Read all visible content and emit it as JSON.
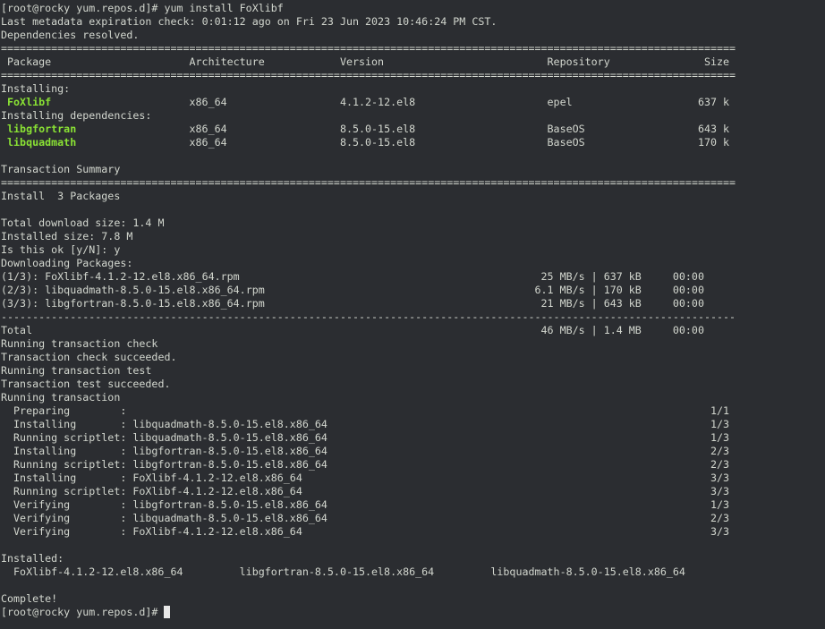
{
  "theme": {
    "background": "#2b2d31",
    "text": "#d3d7cf",
    "package_highlight": "#8ae234"
  },
  "terminal": {
    "prompt": "[root@rocky yum.repos.d]# ",
    "command": "yum install FoXlibf",
    "metadata_line": "Last metadata expiration check: 0:01:12 ago on Fri 23 Jun 2023 10:46:24 PM CST.",
    "deps_resolved": "Dependencies resolved.",
    "separator_char": "=",
    "dash_char": "-",
    "table": {
      "headers": {
        "package": "Package",
        "arch": "Architecture",
        "version": "Version",
        "repo": "Repository",
        "size": "Size"
      },
      "groups": [
        {
          "label": "Installing:",
          "rows": [
            {
              "name": "FoXlibf",
              "arch": "x86_64",
              "version": "4.1.2-12.el8",
              "repo": "epel",
              "size": "637 k"
            }
          ]
        },
        {
          "label": "Installing dependencies:",
          "rows": [
            {
              "name": "libgfortran",
              "arch": "x86_64",
              "version": "8.5.0-15.el8",
              "repo": "BaseOS",
              "size": "643 k"
            },
            {
              "name": "libquadmath",
              "arch": "x86_64",
              "version": "8.5.0-15.el8",
              "repo": "BaseOS",
              "size": "170 k"
            }
          ]
        }
      ]
    },
    "summary": {
      "title": "Transaction Summary",
      "install": "Install  3 Packages"
    },
    "info": [
      "Total download size: 1.4 M",
      "Installed size: 7.8 M",
      "Is this ok [y/N]: y",
      "Downloading Packages:"
    ],
    "downloads": [
      {
        "file": "(1/3): FoXlibf-4.1.2-12.el8.x86_64.rpm",
        "speed": "25 MB/s",
        "size": "637 kB",
        "time": "00:00"
      },
      {
        "file": "(2/3): libquadmath-8.5.0-15.el8.x86_64.rpm",
        "speed": "6.1 MB/s",
        "size": "170 kB",
        "time": "00:00"
      },
      {
        "file": "(3/3): libgfortran-8.5.0-15.el8.x86_64.rpm",
        "speed": "21 MB/s",
        "size": "643 kB",
        "time": "00:00"
      }
    ],
    "total": {
      "file": "Total",
      "speed": "46 MB/s",
      "size": "1.4 MB",
      "time": "00:00"
    },
    "messages": [
      "Running transaction check",
      "Transaction check succeeded.",
      "Running transaction test",
      "Transaction test succeeded.",
      "Running transaction"
    ],
    "steps": [
      {
        "action": "Preparing",
        "package": "",
        "progress": "1/1"
      },
      {
        "action": "Installing",
        "package": "libquadmath-8.5.0-15.el8.x86_64",
        "progress": "1/3"
      },
      {
        "action": "Running scriptlet",
        "package": "libquadmath-8.5.0-15.el8.x86_64",
        "progress": "1/3"
      },
      {
        "action": "Installing",
        "package": "libgfortran-8.5.0-15.el8.x86_64",
        "progress": "2/3"
      },
      {
        "action": "Running scriptlet",
        "package": "libgfortran-8.5.0-15.el8.x86_64",
        "progress": "2/3"
      },
      {
        "action": "Installing",
        "package": "FoXlibf-4.1.2-12.el8.x86_64",
        "progress": "3/3"
      },
      {
        "action": "Running scriptlet",
        "package": "FoXlibf-4.1.2-12.el8.x86_64",
        "progress": "3/3"
      },
      {
        "action": "Verifying",
        "package": "libgfortran-8.5.0-15.el8.x86_64",
        "progress": "1/3"
      },
      {
        "action": "Verifying",
        "package": "libquadmath-8.5.0-15.el8.x86_64",
        "progress": "2/3"
      },
      {
        "action": "Verifying",
        "package": "FoXlibf-4.1.2-12.el8.x86_64",
        "progress": "3/3"
      }
    ],
    "step_separator": ":",
    "installed_label": "Installed:",
    "installed": [
      "FoXlibf-4.1.2-12.el8.x86_64",
      "libgfortran-8.5.0-15.el8.x86_64",
      "libquadmath-8.5.0-15.el8.x86_64"
    ],
    "complete": "Complete!",
    "final_prompt": "[root@rocky yum.repos.d]# "
  }
}
